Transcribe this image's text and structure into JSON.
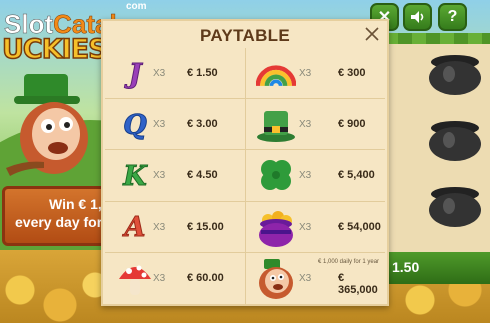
{
  "watermark": {
    "brand_part1": "Slot",
    "brand_part2": "Catalog",
    "suffix": "com"
  },
  "game": {
    "title_fragment": "UCKIEST",
    "banner_line1": "Win € 1,0",
    "banner_line2": "every day for",
    "reel_bet": "1.50"
  },
  "top_buttons": [
    {
      "icon": "close-x-icon",
      "glyph": "✕"
    },
    {
      "icon": "sound-icon",
      "glyph": "🔊"
    },
    {
      "icon": "help-icon",
      "glyph": "?"
    }
  ],
  "paytable": {
    "title": "PAYTABLE",
    "rows": [
      {
        "left": {
          "symbol": "J",
          "symbol_name": "letter-j-icon",
          "color": "#9a3fb8",
          "mult": "X3",
          "prize": "€ 1.50"
        },
        "right": {
          "symbol_name": "rainbow-icon",
          "mult": "X3",
          "prize": "€ 300"
        }
      },
      {
        "left": {
          "symbol": "Q",
          "symbol_name": "letter-q-icon",
          "color": "#2f62c8",
          "mult": "X3",
          "prize": "€ 3.00"
        },
        "right": {
          "symbol_name": "green-hat-icon",
          "mult": "X3",
          "prize": "€ 900"
        }
      },
      {
        "left": {
          "symbol": "K",
          "symbol_name": "letter-k-icon",
          "color": "#3aa845",
          "mult": "X3",
          "prize": "€ 4.50"
        },
        "right": {
          "symbol_name": "four-leaf-clover-icon",
          "mult": "X3",
          "prize": "€ 5,400"
        }
      },
      {
        "left": {
          "symbol": "A",
          "symbol_name": "letter-a-icon",
          "color": "#e0503a",
          "mult": "X3",
          "prize": "€ 15.00"
        },
        "right": {
          "symbol_name": "pot-of-gold-icon",
          "mult": "X3",
          "prize": "€ 54,000"
        }
      },
      {
        "left": {
          "symbol_name": "mushroom-icon",
          "mult": "X3",
          "prize": "€ 60.00"
        },
        "right": {
          "symbol_name": "leprechaun-icon",
          "mult": "X3",
          "prize": "€ 365,000",
          "note": "€ 1,000 daily for 1 year"
        }
      }
    ]
  }
}
